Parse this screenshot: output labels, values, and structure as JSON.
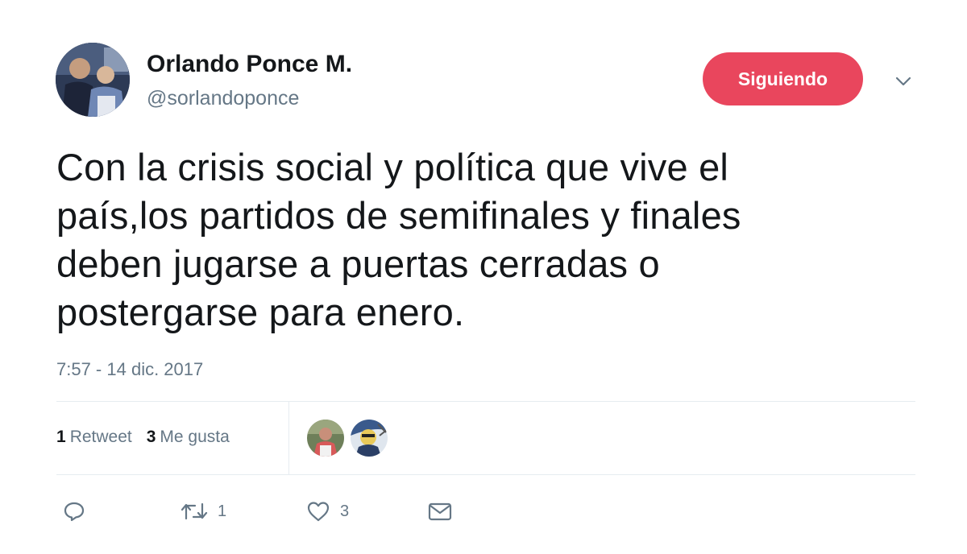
{
  "author": {
    "name": "Orlando Ponce M.",
    "handle": "@sorlandoponce"
  },
  "follow_button": {
    "label": "Siguiendo",
    "color": "#e9465d"
  },
  "tweet": {
    "text": "Con la crisis social y política que vive el\npaís,los partidos de semifinales y finales\ndeben jugarse a puertas cerradas o\npostergarse para enero.",
    "timestamp": "7:57 - 14 dic. 2017"
  },
  "stats": {
    "retweets": {
      "count": "1",
      "label": "Retweet"
    },
    "likes": {
      "count": "3",
      "label": "Me gusta"
    }
  },
  "actions": {
    "reply": {
      "icon": "reply-icon"
    },
    "retweet": {
      "icon": "retweet-icon",
      "count": "1"
    },
    "like": {
      "icon": "heart-icon",
      "count": "3"
    },
    "message": {
      "icon": "envelope-icon"
    }
  },
  "colors": {
    "text": "#14171a",
    "secondary_text": "#657786",
    "divider": "#e6ecf0"
  }
}
